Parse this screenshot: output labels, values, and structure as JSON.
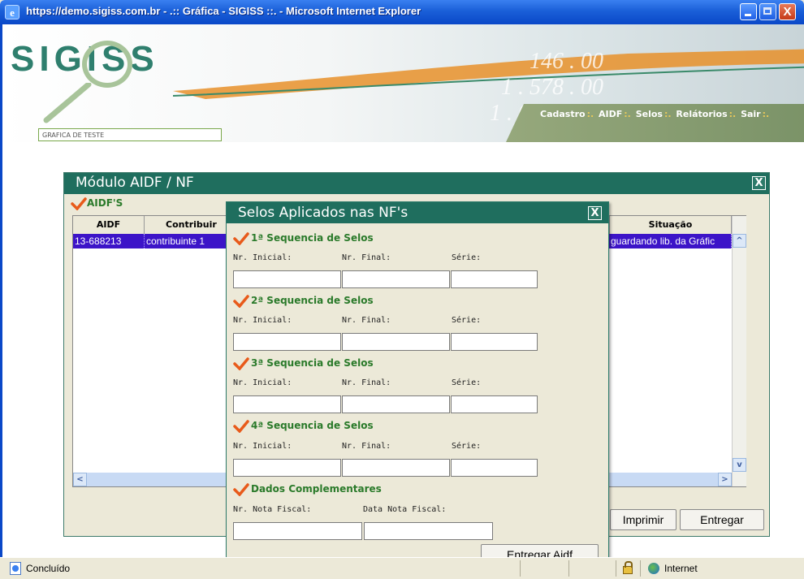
{
  "window": {
    "title": "https://demo.sigiss.com.br - .:: Gráfica - SIGISS ::. - Microsoft Internet Explorer",
    "close_glyph": "X"
  },
  "header": {
    "logo": "SIGISS",
    "user_field": "GRAFICA DE TESTE",
    "nav": [
      "Cadastro",
      "AIDF",
      "Selos",
      "Relátorios",
      "Sair"
    ],
    "nav_separator": ":."
  },
  "module": {
    "title": "Módulo AIDF / NF",
    "close_glyph": "X",
    "section_label": "AIDF'S",
    "columns": [
      "AIDF",
      "Contribuir",
      "Situação"
    ],
    "rows": [
      {
        "aidf": "13-688213",
        "contribuinte": "contribuinte 1",
        "situacao": "guardando lib. da Gráfic"
      }
    ],
    "buttons": {
      "imprimir": "Imprimir",
      "entregar": "Entregar"
    }
  },
  "modal": {
    "title": "Selos Aplicados nas NF's",
    "close_glyph": "X",
    "sequences": [
      {
        "title": "1ª Sequencia de Selos",
        "labels": [
          "Nr. Inicial:",
          "Nr. Final:",
          "Série:"
        ],
        "values": [
          "",
          "",
          ""
        ]
      },
      {
        "title": "2ª Sequencia de Selos",
        "labels": [
          "Nr. Inicial:",
          "Nr. Final:",
          "Série:"
        ],
        "values": [
          "",
          "",
          ""
        ]
      },
      {
        "title": "3ª Sequencia de Selos",
        "labels": [
          "Nr. Inicial:",
          "Nr. Final:",
          "Série:"
        ],
        "values": [
          "",
          "",
          ""
        ]
      },
      {
        "title": "4ª Sequencia de Selos",
        "labels": [
          "Nr. Inicial:",
          "Nr. Final:",
          "Série:"
        ],
        "values": [
          "",
          "",
          ""
        ]
      }
    ],
    "complementares": {
      "title": "Dados Complementares",
      "labels": [
        "Nr. Nota Fiscal:",
        "Data Nota Fiscal:"
      ],
      "values": [
        "",
        ""
      ]
    },
    "submit_label": "Entregar Aidf"
  },
  "statusbar": {
    "text": "Concluído",
    "zone": "Internet"
  },
  "colors": {
    "header_green": "#1f6e5e",
    "accent_check": "#e85a1a",
    "selection": "#3c14c8"
  }
}
